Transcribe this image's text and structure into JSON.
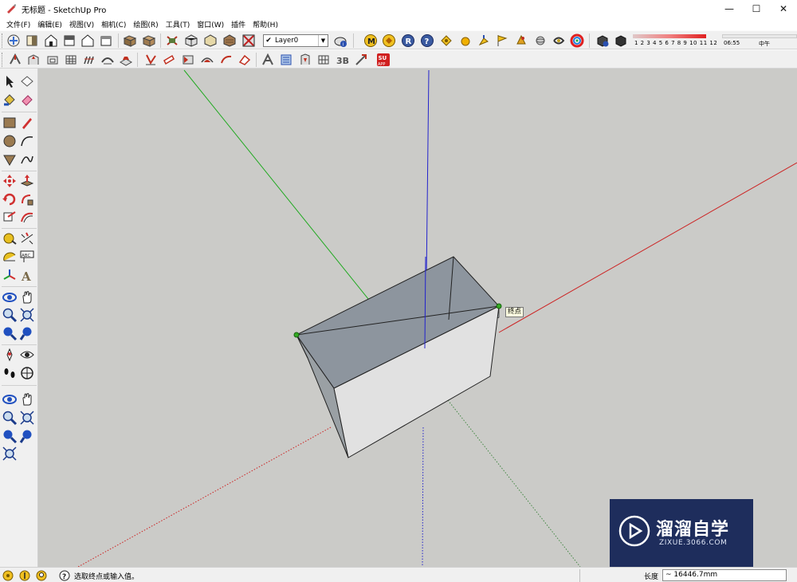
{
  "window": {
    "title": "无标题 - SketchUp Pro",
    "minimize": "—",
    "maximize": "☐",
    "close": "✕"
  },
  "menu": [
    "文件(F)",
    "编辑(E)",
    "视图(V)",
    "相机(C)",
    "绘图(R)",
    "工具(T)",
    "窗口(W)",
    "插件",
    "帮助(H)"
  ],
  "layer": {
    "check": "✔",
    "name": "Layer0",
    "arrow": "▼"
  },
  "shadow": {
    "months": "1 2 3 4 5 6 7 8 9 10 11 12",
    "time": "06:55",
    "noon": "中午"
  },
  "viewport": {
    "inference_tooltip": "终点",
    "colors": {
      "x_axis": "#cc2222",
      "y_axis": "#22aa22",
      "z_axis": "#2222cc",
      "background": "#cbcbc8"
    }
  },
  "watermark": {
    "cn": "溜溜自学",
    "en": "ZIXUE.3066.COM"
  },
  "status": {
    "prompt": "选取终点或输入值。",
    "length_label": "长度",
    "length_value": "~ 16446.7mm"
  },
  "icons": {
    "toolbar1": [
      "getting-started",
      "section-fill",
      "iso-view",
      "top-view",
      "front-view",
      "right-view",
      "back-view",
      "left-view",
      "bottom-view",
      "xray",
      "back-edges",
      "wireframe",
      "hidden-line",
      "shaded",
      "shaded-textures",
      "monochrome",
      "layer-manager",
      "model-info-m",
      "components",
      "render-r",
      "help-q",
      "tags",
      "sun-ball",
      "axes",
      "flag",
      "cone",
      "sphere",
      "swirl",
      "color-wheel",
      "shadows",
      "fog"
    ],
    "toolbar2": [
      "push-pull-a",
      "follow-me",
      "offset",
      "sandbox-grid",
      "contour",
      "smoove",
      "stamp",
      "drape",
      "add-detail",
      "flip",
      "solid-outer",
      "solid-inter",
      "solid-union",
      "solid-subtract",
      "solid-trim",
      "solid-split",
      "extension-warehouse"
    ],
    "left": [
      "select",
      "make-component",
      "paint-bucket",
      "eraser",
      "rectangle",
      "line",
      "circle",
      "arc",
      "polygon",
      "freehand",
      "move",
      "push-pull",
      "rotate",
      "follow-me",
      "scale",
      "offset",
      "tape-measure",
      "dimension",
      "protractor",
      "text",
      "axes",
      "3d-text",
      "orbit",
      "pan",
      "zoom",
      "zoom-extents",
      "previous-view",
      "next-view",
      "position-camera",
      "look-around",
      "walk",
      "section-plane",
      "orbit2",
      "pan2",
      "zoom2",
      "zoom-window",
      "previous2",
      "next2",
      "zoom-extents2"
    ]
  }
}
